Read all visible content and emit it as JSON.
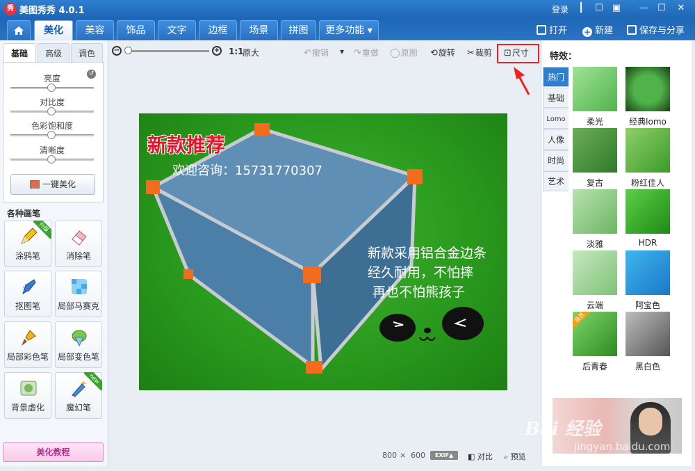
{
  "titlebar": {
    "logo_char": "秀",
    "title": "美图秀秀 4.0.1",
    "login": "登录",
    "controls": [
      "☐",
      "▣",
      "—",
      "☐",
      "✕"
    ]
  },
  "main_tabs": {
    "home_icon": "home-icon",
    "items": [
      "美化",
      "美容",
      "饰品",
      "文字",
      "边框",
      "场景",
      "拼图",
      "更多功能 ▾"
    ]
  },
  "top_actions": {
    "open": "打开",
    "new": "新建",
    "save_share": "保存与分享"
  },
  "left_panel": {
    "tabs": [
      "基础",
      "高级",
      "调色"
    ],
    "sliders": [
      {
        "label": "亮度",
        "value": 0.5
      },
      {
        "label": "对比度",
        "value": 0.5
      },
      {
        "label": "色彩饱和度",
        "value": 0.5
      },
      {
        "label": "清晰度",
        "value": 0.5
      }
    ],
    "one_key": "一键美化",
    "brush_title": "各种画笔",
    "brushes": [
      {
        "label": "涂鸦笔",
        "badge": "升级"
      },
      {
        "label": "消除笔",
        "badge": ""
      },
      {
        "label": "抠图笔",
        "badge": ""
      },
      {
        "label": "局部马赛克",
        "badge": ""
      },
      {
        "label": "局部彩色笔",
        "badge": ""
      },
      {
        "label": "局部变色笔",
        "badge": ""
      },
      {
        "label": "背景虚化",
        "badge": ""
      },
      {
        "label": "魔幻笔",
        "badge": "new"
      }
    ],
    "tutorial": "美化教程"
  },
  "toolbar": {
    "ratio": "1:1",
    "original_size": "原大",
    "undo": "撤销",
    "redo": "重做",
    "original": "原图",
    "rotate": "旋转",
    "crop": "裁剪",
    "size": "尺寸"
  },
  "photo": {
    "headline": "新款推荐",
    "contact": "欢迎咨询：15731770307",
    "lines": [
      "新款采用铝合金边条",
      "经久耐用，不怕摔",
      "再也不怕熊孩子"
    ]
  },
  "status": {
    "width": "800",
    "x": "×",
    "height": "600",
    "exif": "EXIF▲",
    "compare": "对比",
    "preview": "预览"
  },
  "right_panel": {
    "title": "特效：",
    "categories": [
      "热门",
      "基础",
      "Lomo",
      "人像",
      "时尚",
      "艺术"
    ],
    "effects": [
      "柔光",
      "经典lomo",
      "复古",
      "粉红佳人",
      "淡雅",
      "HDR",
      "云端",
      "阿宝色",
      "后青春",
      "黑白色"
    ],
    "effect_badge": "会员"
  },
  "watermark": {
    "text": "Bai 经验",
    "url": "jingyan.baidu.com"
  },
  "colors": {
    "accent": "#2f7fd0",
    "highlight": "#e22222",
    "photo_green": "#2a9a1e"
  }
}
